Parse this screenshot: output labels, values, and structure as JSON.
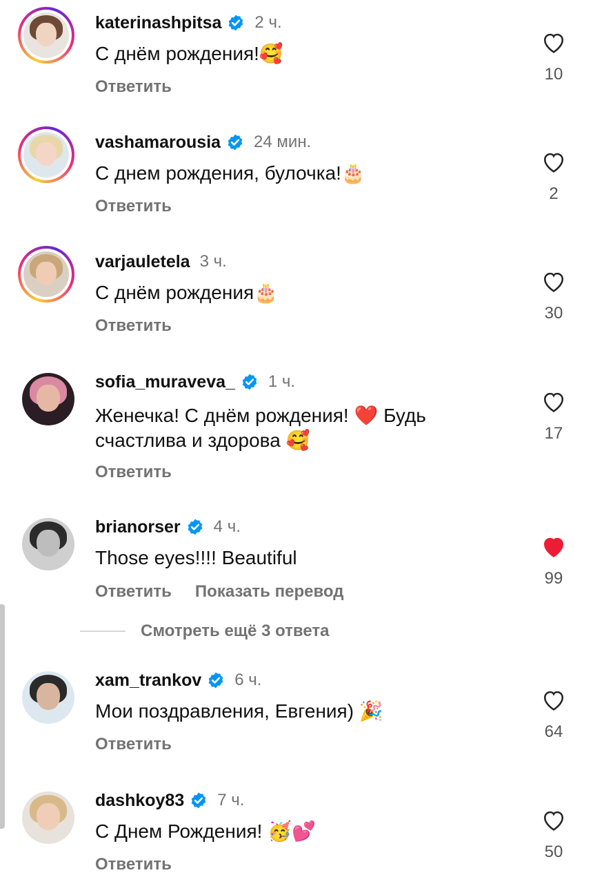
{
  "reply_label": "Ответить",
  "translate_label": "Показать перевод",
  "more_replies": "Смотреть ещё 3 ответа",
  "colors": {
    "liked": "#ed1c35",
    "verified": "#0095f6",
    "muted": "#737373"
  },
  "comments": [
    {
      "username": "katerinashpitsa",
      "verified": true,
      "time": "2 ч.",
      "text": "С днём рождения!🥰",
      "likes": "10",
      "liked": false
    },
    {
      "username": "vashamarousia",
      "verified": true,
      "time": "24 мин.",
      "text": "С днем рождения, булочка!🎂",
      "likes": "2",
      "liked": false
    },
    {
      "username": "varjauletela",
      "verified": false,
      "time": "3 ч.",
      "text": "С днём рождения🎂",
      "likes": "30",
      "liked": false
    },
    {
      "username": "sofia_muraveva_",
      "verified": true,
      "time": "1 ч.",
      "text": "Женечка! С днём рождения! ❤️ Будь счастлива и здорова 🥰",
      "likes": "17",
      "liked": false
    },
    {
      "username": "brianorser",
      "verified": true,
      "time": "4 ч.",
      "text": "Those eyes!!!! Beautiful",
      "likes": "99",
      "liked": true
    },
    {
      "username": "xam_trankov",
      "verified": true,
      "time": "6 ч.",
      "text": "Мои поздравления, Евгения) 🎉",
      "likes": "64",
      "liked": false
    },
    {
      "username": "dashkoy83",
      "verified": true,
      "time": "7 ч.",
      "text": "С Днем Рождения! 🥳💕",
      "likes": "50",
      "liked": false
    }
  ]
}
